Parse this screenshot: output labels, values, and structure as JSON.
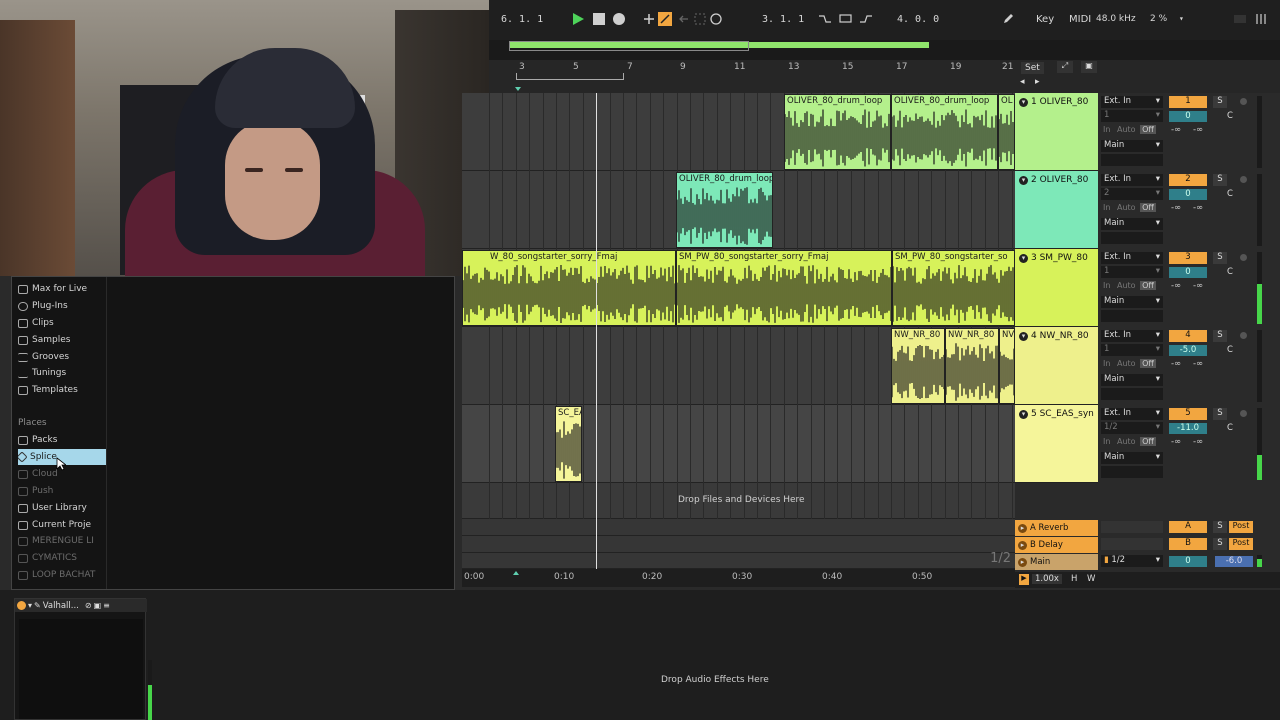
{
  "transport": {
    "arrangement_position": "6.  1.  1",
    "loop_start": "3.  1.  1",
    "loop_length": "4.  0.  0",
    "key_label": "Key",
    "midi_label": "MIDI",
    "sample_rate": "48.0 kHz",
    "cpu": "2 %"
  },
  "ruler": {
    "bars": [
      "3",
      "5",
      "7",
      "9",
      "11",
      "13",
      "15",
      "17",
      "19",
      "21"
    ],
    "set_label": "Set"
  },
  "browser": {
    "categories": [
      {
        "label": "Max for Live",
        "icon": "max-icon"
      },
      {
        "label": "Plug-Ins",
        "icon": "plugin-icon"
      },
      {
        "label": "Clips",
        "icon": "clip-icon"
      },
      {
        "label": "Samples",
        "icon": "sample-icon"
      },
      {
        "label": "Grooves",
        "icon": "groove-icon"
      },
      {
        "label": "Tunings",
        "icon": "tuning-icon"
      },
      {
        "label": "Templates",
        "icon": "template-icon"
      }
    ],
    "places_header": "Places",
    "places": [
      {
        "label": "Packs",
        "icon": "packs-icon",
        "state": "normal"
      },
      {
        "label": "Splice",
        "icon": "splice-icon",
        "state": "selected"
      },
      {
        "label": "Cloud",
        "icon": "cloud-icon",
        "state": "dim"
      },
      {
        "label": "Push",
        "icon": "push-icon",
        "state": "dim"
      },
      {
        "label": "User Library",
        "icon": "folder-icon",
        "state": "normal"
      },
      {
        "label": "Current Proje",
        "icon": "folder-icon",
        "state": "normal"
      },
      {
        "label": "MERENGUE LI",
        "icon": "folder-icon",
        "state": "dim"
      },
      {
        "label": "CYMATICS",
        "icon": "folder-icon",
        "state": "dim"
      },
      {
        "label": "LOOP BACHAT",
        "icon": "folder-icon",
        "state": "dim"
      }
    ]
  },
  "clips": {
    "t1a": "OLIVER_80_drum_loop",
    "t1b": "OLIVER_80_drum_loop",
    "t1c": "OL",
    "t2a": "OLIVER_80_drum_loop",
    "t3a": "W_80_songstarter_sorry_Fmaj",
    "t3b": "SM_PW_80_songstarter_sorry_Fmaj",
    "t3c": "SM_PW_80_songstarter_so",
    "t4a": "NW_NR_80",
    "t4b": "NW_NR_80",
    "t4c": "NV",
    "t5a": "SC_EA"
  },
  "drop_files": "Drop Files and Devices Here",
  "page_indicator": "1/2",
  "time_axis": [
    "0:00",
    "0:10",
    "0:20",
    "0:30",
    "0:40",
    "0:50"
  ],
  "tracks": [
    {
      "name": "1 OLIVER_80",
      "input": "Ext. In",
      "channel": "1",
      "number": "1",
      "volume": "0",
      "pan": "C",
      "color": "#b4f08c"
    },
    {
      "name": "2 OLIVER_80",
      "input": "Ext. In",
      "channel": "2",
      "number": "2",
      "volume": "0",
      "pan": "C",
      "color": "#7de8b8"
    },
    {
      "name": "3 SM_PW_80",
      "input": "Ext. In",
      "channel": "1",
      "number": "3",
      "volume": "0",
      "pan": "C",
      "color": "#d7f25a"
    },
    {
      "name": "4 NW_NR_80",
      "input": "Ext. In",
      "channel": "1",
      "number": "4",
      "volume": "-5.0",
      "pan": "C",
      "color": "#eef08c"
    },
    {
      "name": "5 SC_EAS_syn",
      "input": "Ext. In",
      "channel": "1/2",
      "number": "5",
      "volume": "-11.0",
      "pan": "C",
      "color": "#f5f59a"
    }
  ],
  "mixer_common": {
    "in": "In",
    "auto": "Auto",
    "off": "Off",
    "out": "Main",
    "send_a": "-∞",
    "send_b": "-∞",
    "solo": "S"
  },
  "returns": [
    {
      "name": "A Reverb",
      "letter": "A",
      "post": "Post"
    },
    {
      "name": "B Delay",
      "letter": "B",
      "post": "Post"
    }
  ],
  "master": {
    "name": "Main",
    "channel": "1/2",
    "volume": "0",
    "level": "-6.0",
    "zoom": "1.00x",
    "h": "H",
    "w": "W"
  },
  "device": {
    "name": "Valhall...",
    "drop_fx": "Drop Audio Effects Here"
  }
}
